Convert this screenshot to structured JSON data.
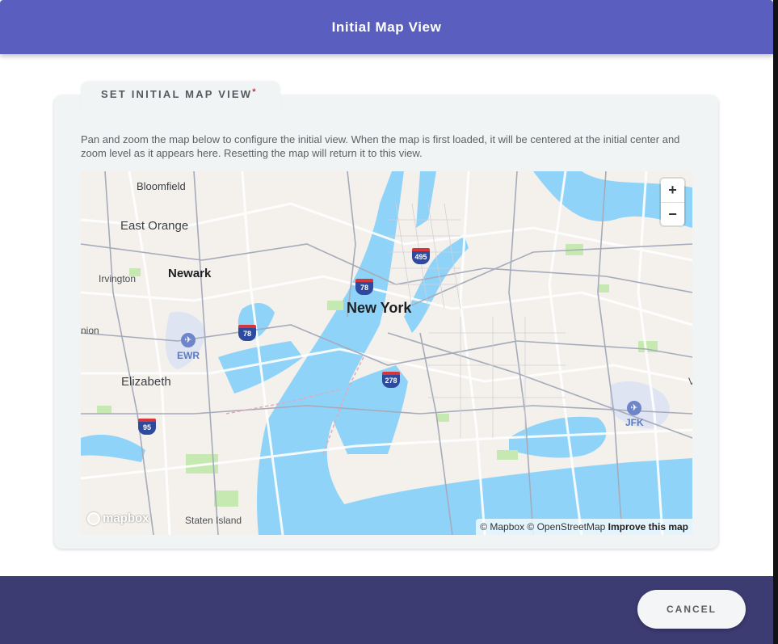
{
  "header": {
    "title": "Initial Map View"
  },
  "section": {
    "tab_label": "SET INITIAL MAP VIEW",
    "required_mark": "*",
    "description": "Pan and zoom the map below to configure the initial view. When the map is first loaded, it will be centered at the initial center and zoom level as it appears here. Resetting the map will return it to this view."
  },
  "map": {
    "labels": {
      "bloomfield": "Bloomfield",
      "east_orange": "East Orange",
      "newark": "Newark",
      "irvington": "Irvington",
      "union": "nion",
      "new_york": "New York",
      "elizabeth": "Elizabeth",
      "staten_island": "Staten Island",
      "edge_v": "V"
    },
    "airports": {
      "ewr": "EWR",
      "jfk": "JFK"
    },
    "shields": {
      "i495": "495",
      "i78_a": "78",
      "i78_b": "78",
      "i278": "278",
      "i95": "95"
    },
    "zoom_in": "+",
    "zoom_out": "−",
    "logo": "mapbox",
    "attribution": "© Mapbox © OpenStreetMap",
    "improve": "Improve this map"
  },
  "footer": {
    "cancel_label": "CANCEL"
  },
  "colors": {
    "header": "#5a5fbf",
    "footer": "#3c3b72",
    "water": "#8fd4f8",
    "park": "#c6e9b2",
    "required": "#c62d3a"
  }
}
